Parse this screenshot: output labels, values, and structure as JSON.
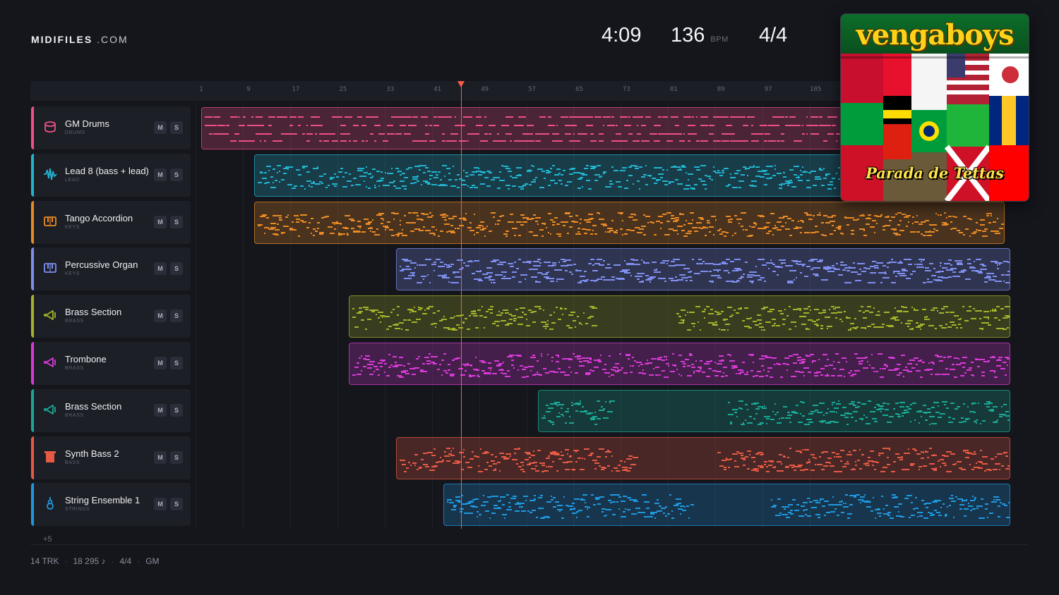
{
  "brand": {
    "name": "MIDIFILES",
    "suffix": ".COM"
  },
  "stats": {
    "duration": "4:09",
    "bpm": "136",
    "bpm_unit": "BPM",
    "time_signature": "4/4"
  },
  "ruler": {
    "bars": [
      "1",
      "9",
      "17",
      "25",
      "33",
      "41",
      "49",
      "57",
      "65",
      "73",
      "81",
      "89",
      "97",
      "105"
    ]
  },
  "playhead_bar": 45,
  "album": {
    "title": "vengaboys",
    "subtitle": "Parada de Tettas"
  },
  "tracks": [
    {
      "name": "GM Drums",
      "category": "DRUMS",
      "color": "#ee4f86",
      "icon": "drum-icon",
      "mute": "M",
      "solo": "S"
    },
    {
      "name": "Lead 8 (bass + lead)",
      "category": "LEAD",
      "color": "#22b3cf",
      "icon": "waveform-icon",
      "mute": "M",
      "solo": "S"
    },
    {
      "name": "Tango Accordion",
      "category": "KEYS",
      "color": "#ea8a25",
      "icon": "keyboard-icon",
      "mute": "M",
      "solo": "S"
    },
    {
      "name": "Percussive Organ",
      "category": "KEYS",
      "color": "#7f8ff0",
      "icon": "keyboard-icon",
      "mute": "M",
      "solo": "S"
    },
    {
      "name": "Brass Section",
      "category": "BRASS",
      "color": "#a5b32a",
      "icon": "horn-icon",
      "mute": "M",
      "solo": "S"
    },
    {
      "name": "Trombone",
      "category": "BRASS",
      "color": "#d83ad8",
      "icon": "horn-icon",
      "mute": "M",
      "solo": "S"
    },
    {
      "name": "Brass Section",
      "category": "BRASS",
      "color": "#1aa894",
      "icon": "horn-icon",
      "mute": "M",
      "solo": "S"
    },
    {
      "name": "Synth Bass 2",
      "category": "BASS",
      "color": "#e65a44",
      "icon": "bass-icon",
      "mute": "M",
      "solo": "S"
    },
    {
      "name": "String Ensemble 1",
      "category": "STRINGS",
      "color": "#1f98e0",
      "icon": "violin-icon",
      "mute": "M",
      "solo": "S"
    }
  ],
  "more_tracks": "+5",
  "footer": {
    "tracks": "14 TRK",
    "notes": "18 295 ♪",
    "time_signature": "4/4",
    "standard": "GM"
  }
}
